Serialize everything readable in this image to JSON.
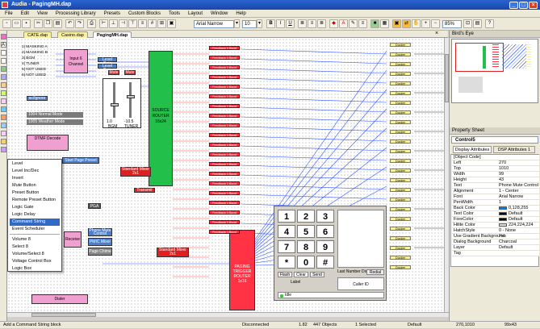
{
  "window": {
    "title": "Audia - PagingMH.dap",
    "min": "_",
    "max": "□",
    "close": "×"
  },
  "menu": [
    "File",
    "Edit",
    "View",
    "Processing Library",
    "Presets",
    "Custom Blocks",
    "Tools",
    "Layout",
    "Window",
    "Help"
  ],
  "toolbar": {
    "font": "Arial Narrow",
    "size": "10",
    "zoom": "85%",
    "bold": "B",
    "italic": "I",
    "underline": "U"
  },
  "tabs": [
    {
      "label": "CATE.dap"
    },
    {
      "label": "Casino.dap"
    },
    {
      "label": "PagingMH.dap"
    }
  ],
  "context_menu": [
    "Level",
    "Level Inc/Dec",
    "Invert",
    "Mute Button",
    "Preset Button",
    "Remote Preset Button",
    "Logic Gate",
    "Logic Delay",
    "Command String",
    "Event Scheduler",
    "Volume 8",
    "Select 8",
    "Volume/Select 8",
    "Voltage Control Box",
    "Logic Box"
  ],
  "context_menu_highlight": "Command String",
  "canvas": {
    "input_labels": [
      "1|",
      "2|",
      "3|",
      "4|",
      "5|",
      "6|"
    ],
    "input_names": [
      "MASKING A",
      "MASKING B",
      "BGM",
      "TUNER",
      "NOT USED",
      "NOT USED"
    ],
    "input_block": "Input 6 Channel",
    "level_gains": [
      "Level Gain",
      "Level Gain"
    ],
    "mute": [
      "Mute",
      "Mute"
    ],
    "source_router": "SOURCE ROUTER 16x24",
    "mode_label": "ac/Ignore",
    "modes": [
      {
        "id": "1004",
        "name": "Normal Mode"
      },
      {
        "id": "1005",
        "name": "Weather Mode"
      }
    ],
    "fader_values": [
      "1.0",
      "-10.5"
    ],
    "fader_labels": [
      "BGM",
      "TUNER"
    ],
    "dtmf": "DTMF Decode",
    "page_preset": "Start Page Preset",
    "standard_mixer": "Standard Mixer 2x1",
    "transmit": "Transmit",
    "pga": "PGA",
    "receive": "Receive",
    "phone_mute": "Phone Mute Control",
    "pmic_mixer": "PMIC Mixer",
    "page_chime": "Page Chime",
    "standard_mixer2": "Standard Mixer 2x1",
    "paging_router": "PAGING TRIGGER ROUTER 1x16",
    "dialer": "Dialer",
    "feedback_label": "Feedback 1 Band",
    "ducker_label": "Ducker"
  },
  "keypad": {
    "keys": [
      "1",
      "2",
      "3",
      "4",
      "5",
      "6",
      "7",
      "8",
      "9",
      "*",
      "0",
      "#"
    ],
    "buttons": [
      "Flash",
      "Clear",
      "Send"
    ],
    "label": "Label",
    "last_dialed": "Last Number Dialed",
    "redial": "Redial",
    "caller_id": "Caller ID",
    "status": "Idle"
  },
  "birdseye": {
    "title": "Bird's Eye"
  },
  "property_sheet": {
    "title": "Property Sheet",
    "selected": "Control5",
    "tabs": [
      "Display Attributes",
      "DSP Attributes 1"
    ],
    "rows": [
      [
        "[Object Code]",
        ""
      ],
      [
        "Left",
        "270"
      ],
      [
        "Top",
        "1010"
      ],
      [
        "Width",
        "99"
      ],
      [
        "Height",
        "43"
      ],
      [
        "Text",
        "Phone Mute Control"
      ],
      [
        "Alignment",
        "1 - Center"
      ],
      [
        "Font",
        "Arial Narrow"
      ],
      [
        "PenWidth",
        "1"
      ],
      [
        "Back Color",
        "0,128,255"
      ],
      [
        "Text Color",
        "Default"
      ],
      [
        "ForeColor",
        "Default"
      ],
      [
        "Hilite Color",
        "224,224,224"
      ],
      [
        "HatchStyle",
        "0 - None"
      ],
      [
        "Use Gradient Background",
        "Yes"
      ],
      [
        "Dialog Background",
        "Charcoal"
      ],
      [
        "Layer",
        "Default"
      ],
      [
        "Tag",
        ""
      ]
    ],
    "colors": {
      "Back Color": "#0080ff",
      "Text Color": "#000000",
      "ForeColor": "#000000",
      "Hilite Color": "#e0e0e0"
    }
  },
  "status": {
    "hint": "Add a Command String block",
    "conn": "Disconnected",
    "ver": "1.82",
    "objects": "447 Objects",
    "selected": "1 Selected",
    "default": "Default",
    "coords": "270,1010",
    "size": "99x43"
  },
  "colors": {
    "accent": "#2a63d0",
    "router": "#22c04a",
    "feedback": "#ff3344",
    "ducker": "#f6f0a0",
    "dtmf": "#f0a0d0",
    "mixer": "#e02020",
    "paging": "#ff3344",
    "phone": "#4a7fd0"
  }
}
